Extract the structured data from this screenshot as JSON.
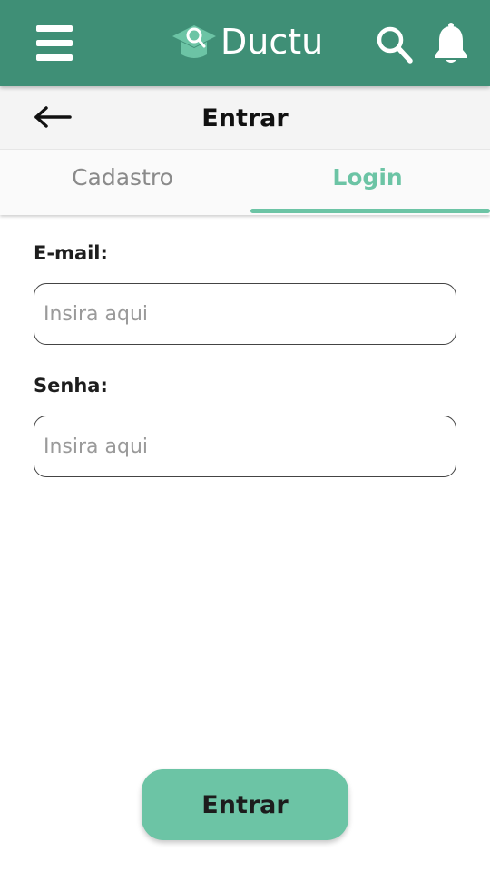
{
  "app": {
    "name": "Ductu",
    "primary_color": "#3f8f76",
    "accent_color": "#6cc4a5"
  },
  "header": {
    "menu_icon": "hamburger-menu-icon",
    "logo_icon": "graduation-cap-magnifier-icon",
    "search_icon": "search-icon",
    "notification_icon": "bell-icon"
  },
  "subheader": {
    "back_icon": "arrow-left-icon",
    "title": "Entrar"
  },
  "tabs": [
    {
      "label": "Cadastro",
      "active": false
    },
    {
      "label": "Login",
      "active": true
    }
  ],
  "form": {
    "email": {
      "label": "E-mail:",
      "placeholder": "Insira aqui",
      "value": ""
    },
    "password": {
      "label": "Senha:",
      "placeholder": "Insira aqui",
      "value": ""
    },
    "submit_label": "Entrar"
  }
}
